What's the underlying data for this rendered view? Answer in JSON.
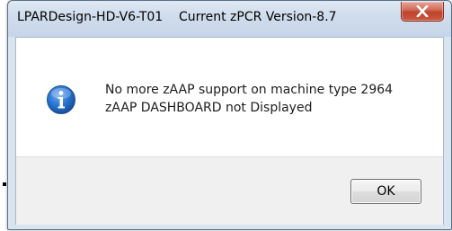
{
  "window": {
    "title": "LPARDesign-HD-V6-T01    Current zPCR Version-8.7",
    "close_icon": "close-icon"
  },
  "message": {
    "icon": "info-icon",
    "line1": "No more zAAP support on machine type 2964",
    "line2": "zAAP DASHBOARD not Displayed"
  },
  "buttons": {
    "ok_label": "OK"
  },
  "colors": {
    "frame": "#d9e4f1",
    "close_button": "#c0432c",
    "info_icon": "#1f6bc4",
    "button_bar": "#f0f0f0"
  }
}
